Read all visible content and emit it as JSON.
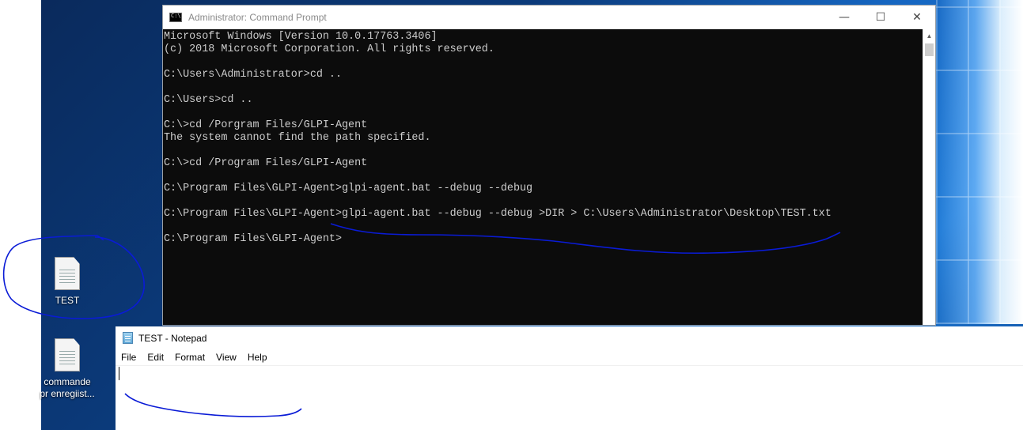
{
  "desktop": {
    "icons": [
      {
        "label": "TEST"
      },
      {
        "label_line1": "commande",
        "label_line2": "pr enregiist..."
      }
    ]
  },
  "cmd": {
    "title": "Administrator: Command Prompt",
    "controls": {
      "minimize": "—",
      "maximize": "☐",
      "close": "✕"
    },
    "lines": [
      "Microsoft Windows [Version 10.0.17763.3406]",
      "(c) 2018 Microsoft Corporation. All rights reserved.",
      "",
      "C:\\Users\\Administrator>cd ..",
      "",
      "C:\\Users>cd ..",
      "",
      "C:\\>cd /Porgram Files/GLPI-Agent",
      "The system cannot find the path specified.",
      "",
      "C:\\>cd /Program Files/GLPI-Agent",
      "",
      "C:\\Program Files\\GLPI-Agent>glpi-agent.bat --debug --debug",
      "",
      "C:\\Program Files\\GLPI-Agent>glpi-agent.bat --debug --debug >DIR > C:\\Users\\Administrator\\Desktop\\TEST.txt",
      "",
      "C:\\Program Files\\GLPI-Agent>"
    ]
  },
  "notepad": {
    "title": "TEST - Notepad",
    "menu": [
      "File",
      "Edit",
      "Format",
      "View",
      "Help"
    ],
    "content": ""
  },
  "colors": {
    "annotation": "#0a1bd6",
    "console_bg": "#0c0c0c",
    "console_text": "#cccccc"
  }
}
